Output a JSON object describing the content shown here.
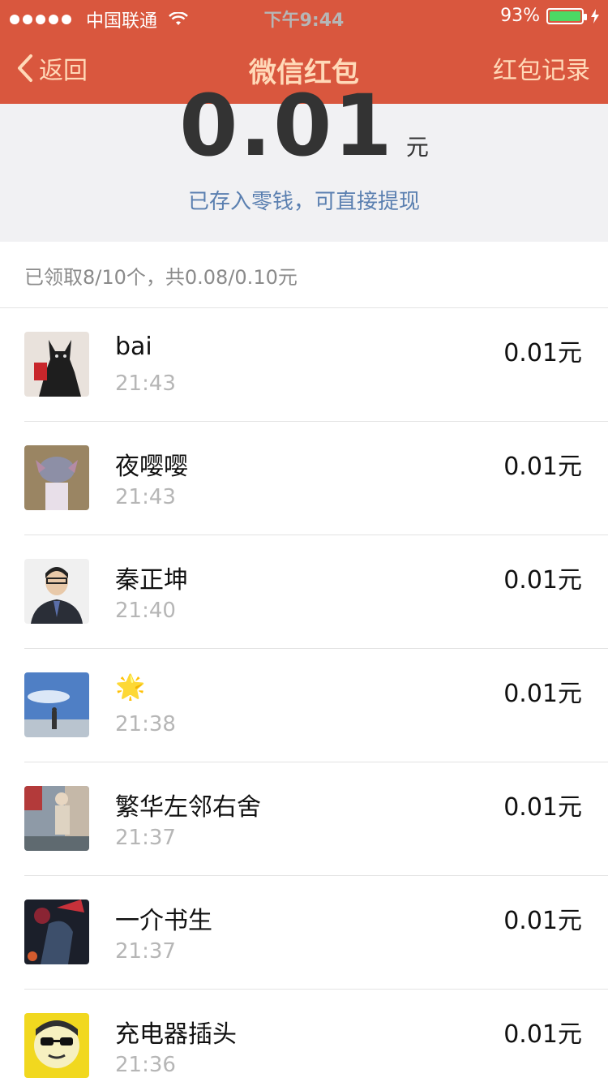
{
  "status_bar": {
    "carrier": "中国联通",
    "time": "下午9:44",
    "battery": "93%",
    "battery_level": 0.93,
    "icons": [
      "signal-dots-icon",
      "wifi-icon",
      "battery-icon",
      "charging-bolt-icon"
    ]
  },
  "nav": {
    "back_label": "返回",
    "title": "微信红包",
    "right_label": "红包记录"
  },
  "summary": {
    "amount": "0.01",
    "unit": "元",
    "note": "已存入零钱，可直接提现"
  },
  "count_text": "已领取8/10个，共0.08/0.10元",
  "records": [
    {
      "name": "bai",
      "time": "21:43",
      "amount": "0.01元"
    },
    {
      "name": "夜嘤嘤",
      "time": "21:43",
      "amount": "0.01元"
    },
    {
      "name": "秦正坤",
      "time": "21:40",
      "amount": "0.01元"
    },
    {
      "name": "🌟",
      "time": "21:38",
      "amount": "0.01元"
    },
    {
      "name": "繁华左邻右舍",
      "time": "21:37",
      "amount": "0.01元"
    },
    {
      "name": "一介书生",
      "time": "21:37",
      "amount": "0.01元"
    },
    {
      "name": "充电器插头",
      "time": "21:36",
      "amount": "0.01元"
    }
  ],
  "colors": {
    "header_bg": "#d9573e",
    "nav_text": "#ffd9b8",
    "summary_bg": "#f1f1f3",
    "note_text": "#5a7fb0",
    "battery_fill": "#4cd964"
  }
}
